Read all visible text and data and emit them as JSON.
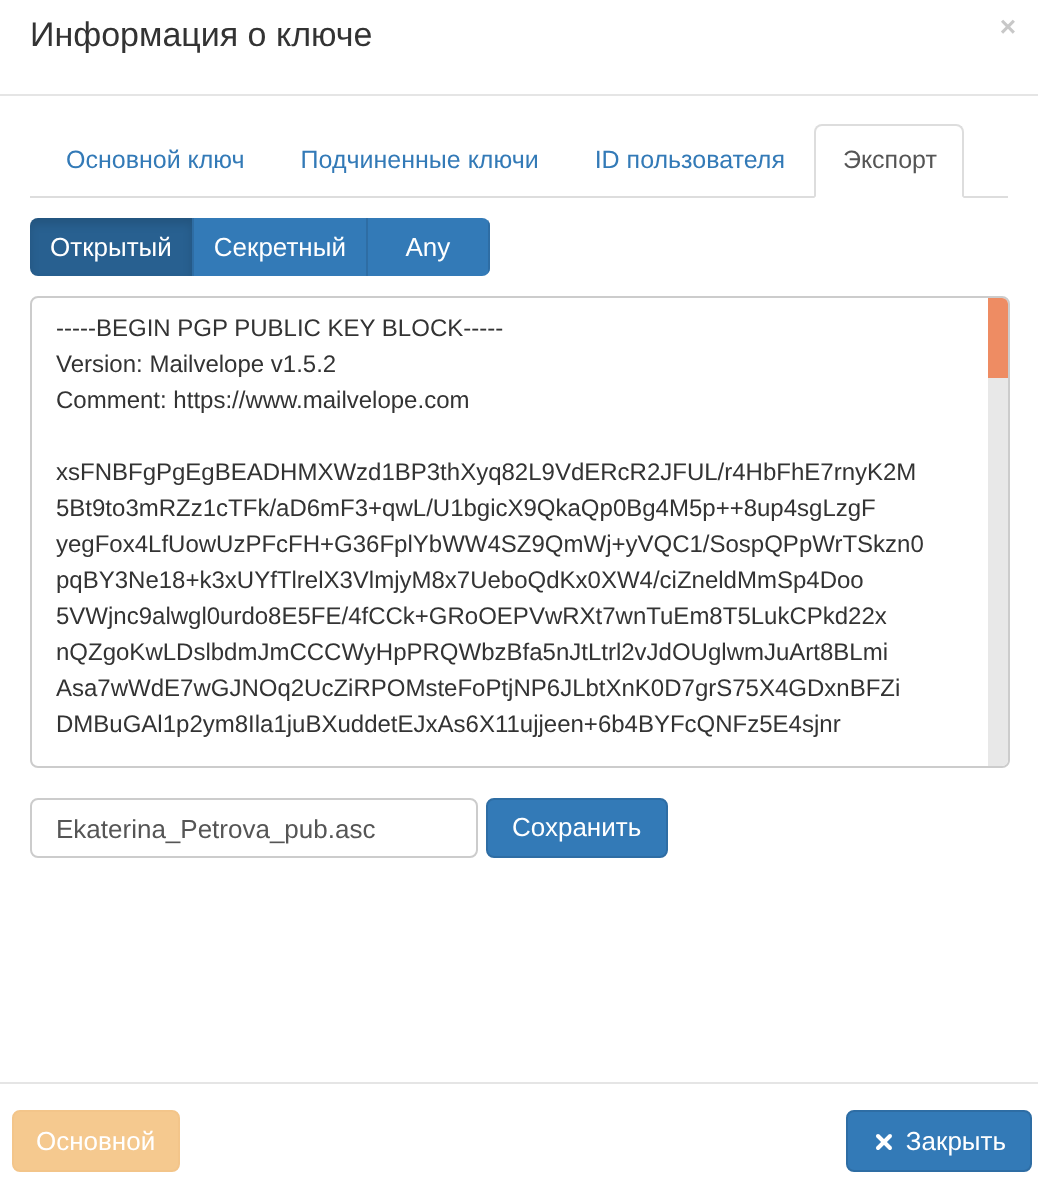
{
  "dialog": {
    "title": "Информация о ключе",
    "close": "×"
  },
  "tabs": [
    {
      "label": "Основной ключ",
      "selected": false
    },
    {
      "label": "Подчиненные ключи",
      "selected": false
    },
    {
      "label": "ID пользователя",
      "selected": false
    },
    {
      "label": "Экспорт",
      "selected": true
    }
  ],
  "key_types": [
    {
      "label": "Открытый",
      "selected": true
    },
    {
      "label": "Секретный",
      "selected": false
    },
    {
      "label": "Any",
      "selected": false
    }
  ],
  "key_header": [
    "-----BEGIN PGP PUBLIC KEY BLOCK-----",
    "Version: Mailvelope v1.5.2",
    "Comment: https://www.mailvelope.com"
  ],
  "key_body": [
    "xsFNBFgPgEgBEADHMXWzd1BP3thXyq82L9VdERcR2JFUL/r4HbFhE7rnyK2M",
    "5Bt9to3mRZz1cTFk/aD6mF3+qwL/U1bgicX9QkaQp0Bg4M5p++8up4sgLzgF",
    "yegFox4LfUowUzPFcFH+G36FplYbWW4SZ9QmWj+yVQC1/SospQPpWrTSkzn0",
    "pqBY3Ne18+k3xUYfTlrelX3VlmjyM8x7UeboQdKx0XW4/ciZneldMmSp4Doo",
    "5VWjnc9alwgl0urdo8E5FE/4fCCk+GRoOEPVwRXt7wnTuEm8T5LukCPkd22x",
    "nQZgoKwLDslbdmJmCCCWyHpPRQWbzBfa5nJtLtrl2vJdOUglwmJuArt8BLmi",
    "Asa7wWdE7wGJNOq2UcZiRPOMsteFoPtjNP6JLbtXnK0D7grS75X4GDxnBFZi",
    "DMBuGAl1p2ym8Ila1juBXuddetEJxAs6X11ujjeen+6b4BYFcQNFz5E4sjnr"
  ],
  "file_name": "Ekaterina_Petrova_pub.asc",
  "save_button": "Сохранить",
  "footer": {
    "primary_button": {
      "label": "Основной",
      "disabled": true
    },
    "close_button": "Закрыть"
  }
}
